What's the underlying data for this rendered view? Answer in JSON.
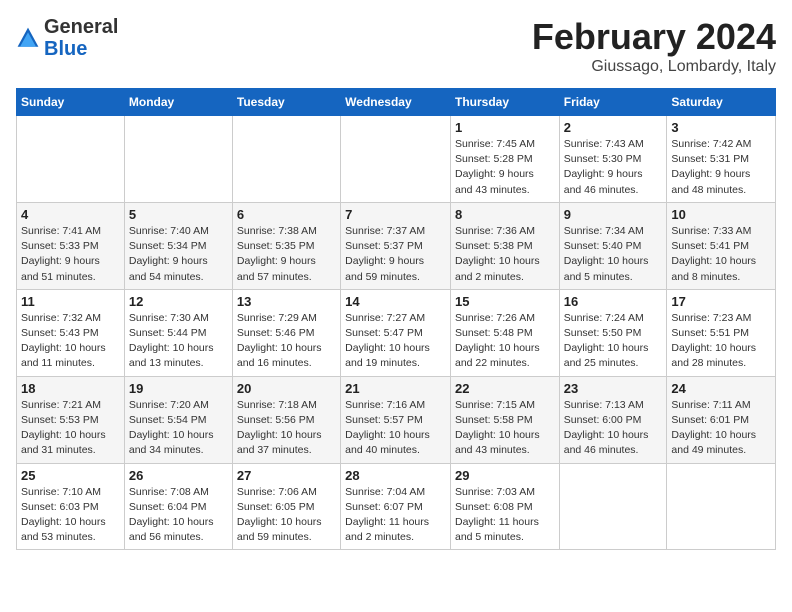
{
  "header": {
    "logo_general": "General",
    "logo_blue": "Blue",
    "title": "February 2024",
    "subtitle": "Giussago, Lombardy, Italy"
  },
  "weekdays": [
    "Sunday",
    "Monday",
    "Tuesday",
    "Wednesday",
    "Thursday",
    "Friday",
    "Saturday"
  ],
  "weeks": [
    [
      {
        "day": "",
        "info": ""
      },
      {
        "day": "",
        "info": ""
      },
      {
        "day": "",
        "info": ""
      },
      {
        "day": "",
        "info": ""
      },
      {
        "day": "1",
        "info": "Sunrise: 7:45 AM\nSunset: 5:28 PM\nDaylight: 9 hours\nand 43 minutes."
      },
      {
        "day": "2",
        "info": "Sunrise: 7:43 AM\nSunset: 5:30 PM\nDaylight: 9 hours\nand 46 minutes."
      },
      {
        "day": "3",
        "info": "Sunrise: 7:42 AM\nSunset: 5:31 PM\nDaylight: 9 hours\nand 48 minutes."
      }
    ],
    [
      {
        "day": "4",
        "info": "Sunrise: 7:41 AM\nSunset: 5:33 PM\nDaylight: 9 hours\nand 51 minutes."
      },
      {
        "day": "5",
        "info": "Sunrise: 7:40 AM\nSunset: 5:34 PM\nDaylight: 9 hours\nand 54 minutes."
      },
      {
        "day": "6",
        "info": "Sunrise: 7:38 AM\nSunset: 5:35 PM\nDaylight: 9 hours\nand 57 minutes."
      },
      {
        "day": "7",
        "info": "Sunrise: 7:37 AM\nSunset: 5:37 PM\nDaylight: 9 hours\nand 59 minutes."
      },
      {
        "day": "8",
        "info": "Sunrise: 7:36 AM\nSunset: 5:38 PM\nDaylight: 10 hours\nand 2 minutes."
      },
      {
        "day": "9",
        "info": "Sunrise: 7:34 AM\nSunset: 5:40 PM\nDaylight: 10 hours\nand 5 minutes."
      },
      {
        "day": "10",
        "info": "Sunrise: 7:33 AM\nSunset: 5:41 PM\nDaylight: 10 hours\nand 8 minutes."
      }
    ],
    [
      {
        "day": "11",
        "info": "Sunrise: 7:32 AM\nSunset: 5:43 PM\nDaylight: 10 hours\nand 11 minutes."
      },
      {
        "day": "12",
        "info": "Sunrise: 7:30 AM\nSunset: 5:44 PM\nDaylight: 10 hours\nand 13 minutes."
      },
      {
        "day": "13",
        "info": "Sunrise: 7:29 AM\nSunset: 5:46 PM\nDaylight: 10 hours\nand 16 minutes."
      },
      {
        "day": "14",
        "info": "Sunrise: 7:27 AM\nSunset: 5:47 PM\nDaylight: 10 hours\nand 19 minutes."
      },
      {
        "day": "15",
        "info": "Sunrise: 7:26 AM\nSunset: 5:48 PM\nDaylight: 10 hours\nand 22 minutes."
      },
      {
        "day": "16",
        "info": "Sunrise: 7:24 AM\nSunset: 5:50 PM\nDaylight: 10 hours\nand 25 minutes."
      },
      {
        "day": "17",
        "info": "Sunrise: 7:23 AM\nSunset: 5:51 PM\nDaylight: 10 hours\nand 28 minutes."
      }
    ],
    [
      {
        "day": "18",
        "info": "Sunrise: 7:21 AM\nSunset: 5:53 PM\nDaylight: 10 hours\nand 31 minutes."
      },
      {
        "day": "19",
        "info": "Sunrise: 7:20 AM\nSunset: 5:54 PM\nDaylight: 10 hours\nand 34 minutes."
      },
      {
        "day": "20",
        "info": "Sunrise: 7:18 AM\nSunset: 5:56 PM\nDaylight: 10 hours\nand 37 minutes."
      },
      {
        "day": "21",
        "info": "Sunrise: 7:16 AM\nSunset: 5:57 PM\nDaylight: 10 hours\nand 40 minutes."
      },
      {
        "day": "22",
        "info": "Sunrise: 7:15 AM\nSunset: 5:58 PM\nDaylight: 10 hours\nand 43 minutes."
      },
      {
        "day": "23",
        "info": "Sunrise: 7:13 AM\nSunset: 6:00 PM\nDaylight: 10 hours\nand 46 minutes."
      },
      {
        "day": "24",
        "info": "Sunrise: 7:11 AM\nSunset: 6:01 PM\nDaylight: 10 hours\nand 49 minutes."
      }
    ],
    [
      {
        "day": "25",
        "info": "Sunrise: 7:10 AM\nSunset: 6:03 PM\nDaylight: 10 hours\nand 53 minutes."
      },
      {
        "day": "26",
        "info": "Sunrise: 7:08 AM\nSunset: 6:04 PM\nDaylight: 10 hours\nand 56 minutes."
      },
      {
        "day": "27",
        "info": "Sunrise: 7:06 AM\nSunset: 6:05 PM\nDaylight: 10 hours\nand 59 minutes."
      },
      {
        "day": "28",
        "info": "Sunrise: 7:04 AM\nSunset: 6:07 PM\nDaylight: 11 hours\nand 2 minutes."
      },
      {
        "day": "29",
        "info": "Sunrise: 7:03 AM\nSunset: 6:08 PM\nDaylight: 11 hours\nand 5 minutes."
      },
      {
        "day": "",
        "info": ""
      },
      {
        "day": "",
        "info": ""
      }
    ]
  ]
}
